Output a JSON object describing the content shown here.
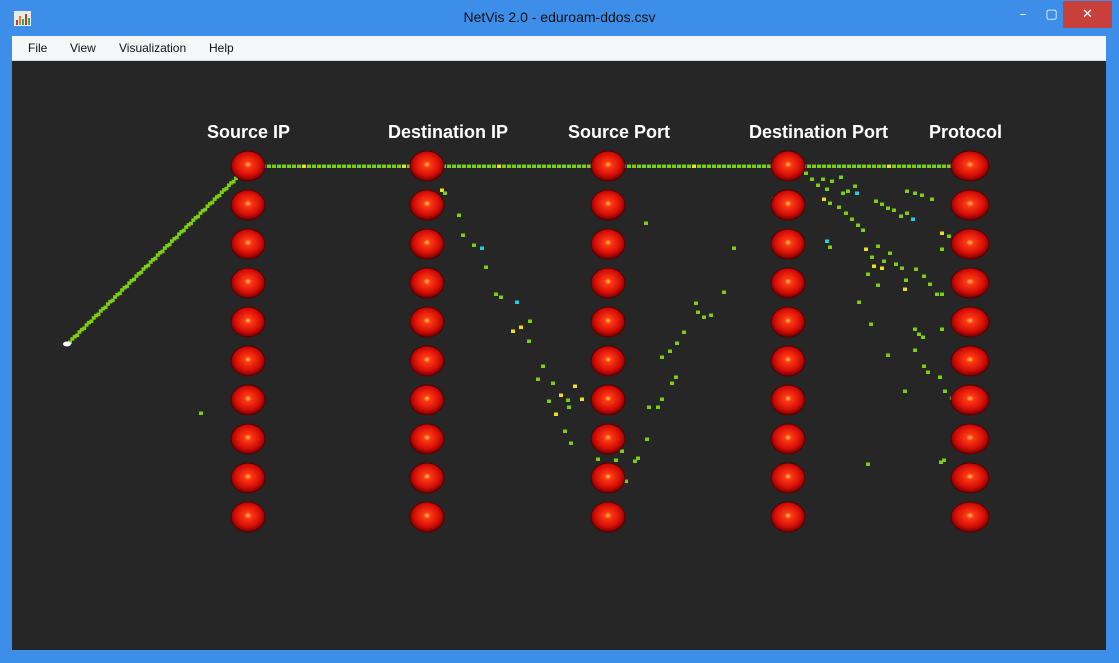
{
  "window": {
    "title": "NetVis 2.0 - eduroam-ddos.csv",
    "controls": {
      "minimize": "–",
      "maximize": "▢",
      "close": "✕"
    },
    "accent_color": "#3c8ee8"
  },
  "menu": {
    "items": [
      "File",
      "View",
      "Visualization",
      "Help"
    ]
  },
  "visualization": {
    "type": "parallel-coordinates",
    "background": "#262626",
    "axes": [
      "Source IP",
      "Destination IP",
      "Source Port",
      "Destination Port",
      "Protocol"
    ],
    "nodes_per_axis": 10,
    "node_color": "#e01010",
    "point_colors": {
      "green": "#7ccf10",
      "yellow": "#e8e020",
      "cyan": "#20d0e0",
      "white": "#ffffff"
    }
  }
}
